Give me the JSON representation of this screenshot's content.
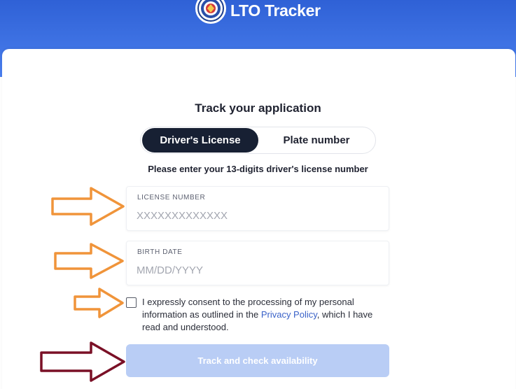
{
  "app": {
    "brand_name": "LTO Tracker"
  },
  "form": {
    "title": "Track your application",
    "tabs": [
      {
        "label": "Driver's License",
        "active": true
      },
      {
        "label": "Plate number",
        "active": false
      }
    ],
    "instruction": "Please enter your 13-digits driver's license number",
    "license_field": {
      "label": "LICENSE NUMBER",
      "placeholder": "XXXXXXXXXXXXX",
      "value": ""
    },
    "birth_field": {
      "label": "BIRTH DATE",
      "placeholder": "MM/DD/YYYY",
      "value": ""
    },
    "consent": {
      "checked": false,
      "text_before": "I expressly consent to the processing of my personal information as outlined in the ",
      "link_text": "Privacy Policy",
      "text_after": ", which I have read and understood."
    },
    "submit_label": "Track and check availability"
  },
  "colors": {
    "header_blue": "#3a6ce0",
    "active_tab": "#172033",
    "submit_disabled": "#b9cdf5",
    "link": "#3a62c8",
    "annotation_orange": "#f0943a",
    "annotation_maroon": "#7a1026"
  },
  "icons": {
    "logo": "lto-seal-icon",
    "annotation_arrows": "arrow-right-outline-icon"
  }
}
